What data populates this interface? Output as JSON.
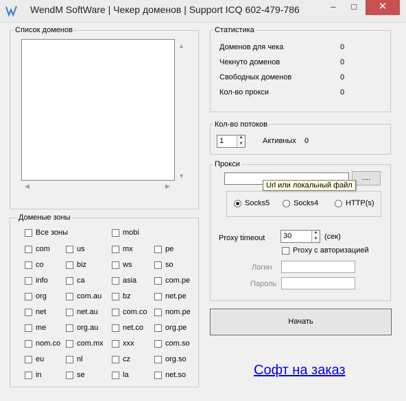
{
  "window": {
    "title": "WendM SoftWare | Чекер доменов |  Support ICQ 602-479-786",
    "minimize": "–",
    "maximize": "□",
    "close": "✕"
  },
  "domains_group": {
    "label": "Список доменов"
  },
  "zones_group": {
    "label": "Доменые зоны",
    "all_zones": "Все зоны",
    "mobi": "mobi",
    "rows": [
      [
        "com",
        "us",
        "mx",
        "pe"
      ],
      [
        "co",
        "biz",
        "ws",
        "so"
      ],
      [
        "info",
        "ca",
        "asia",
        "com.pe"
      ],
      [
        "org",
        "com.au",
        "bz",
        "net.pe"
      ],
      [
        "net",
        "net.au",
        "com.co",
        "nom.pe"
      ],
      [
        "me",
        "org.au",
        "net.co",
        "org.pe"
      ],
      [
        "nom.co",
        "com.mx",
        "xxx",
        "com.so"
      ],
      [
        "eu",
        "nl",
        "cz",
        "org.so"
      ],
      [
        "in",
        "se",
        "la",
        "net.so"
      ]
    ]
  },
  "stats": {
    "label": "Статистика",
    "rows": [
      {
        "name": "Доменов для чека",
        "value": "0"
      },
      {
        "name": "Чекнуто доменов",
        "value": "0"
      },
      {
        "name": "Свободных доменов",
        "value": "0"
      },
      {
        "name": "Кол-во прокси",
        "value": "0"
      }
    ]
  },
  "threads": {
    "label": "Кол-во потоков",
    "value": "1",
    "active_label": "Активных",
    "active_value": "0"
  },
  "proxy": {
    "label": "Прокси",
    "url_value": "",
    "browse_label": "....",
    "tooltip": "Url или локальный файл",
    "types": [
      "Socks5",
      "Socks4",
      "HTTP(s)"
    ],
    "selected_type": "Socks5",
    "timeout_label": "Proxy timeout",
    "timeout_value": "30",
    "timeout_unit": "(сек)",
    "auth_label": "Proxy с авторизацией",
    "login_label": "Логин",
    "password_label": "Пароль"
  },
  "start_button": "Начать",
  "order_link": "Софт на заказ"
}
